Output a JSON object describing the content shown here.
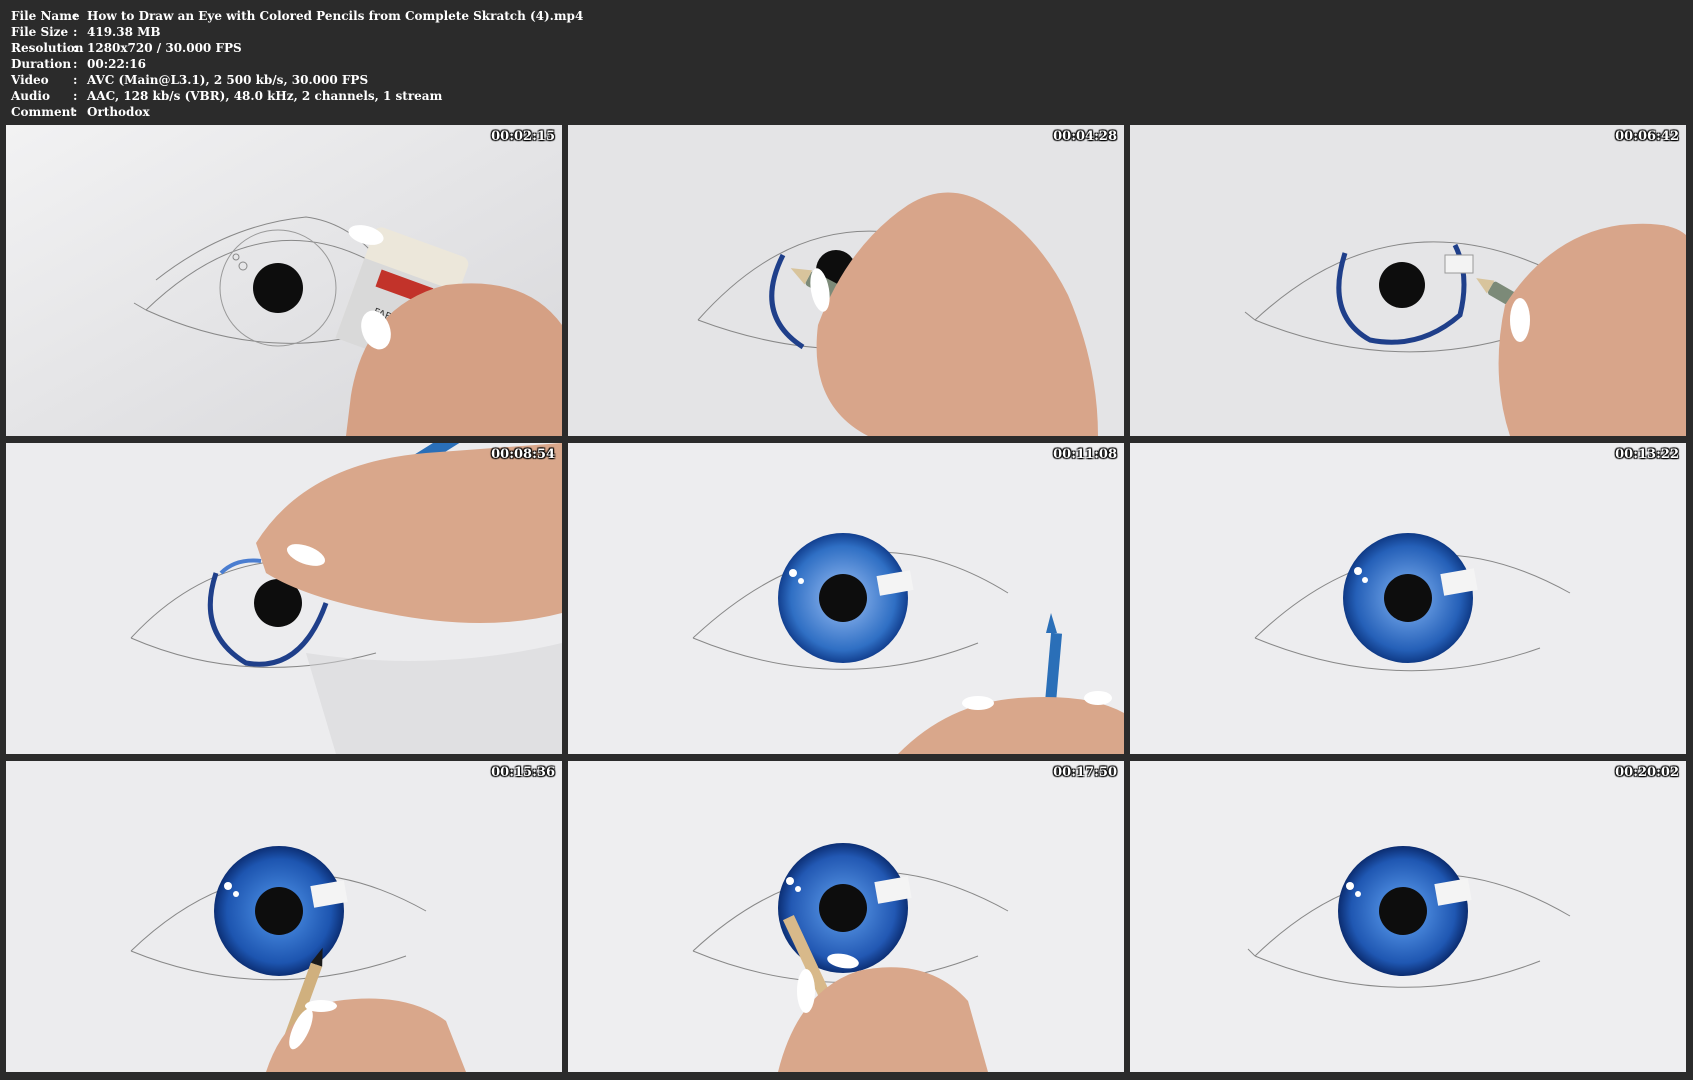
{
  "info": {
    "rows": [
      {
        "label": "File Name",
        "value": "How to Draw an Eye with Colored Pencils from Complete Skratch (4).mp4"
      },
      {
        "label": "File Size",
        "value": "419.38 MB"
      },
      {
        "label": "Resolution",
        "value": "1280x720 / 30.000 FPS"
      },
      {
        "label": "Duration",
        "value": "00:22:16"
      },
      {
        "label": "Video",
        "value": "AVC (Main@L3.1), 2 500 kb/s, 30.000 FPS"
      },
      {
        "label": "Audio",
        "value": "AAC, 128 kb/s (VBR), 48.0 kHz, 2 channels, 1 stream"
      },
      {
        "label": "Comment",
        "value": "Orthodox"
      }
    ],
    "separator": ":"
  },
  "thumbnails": [
    {
      "timestamp": "00:02:15",
      "scene": "sketch-eraser"
    },
    {
      "timestamp": "00:04:28",
      "scene": "outline-iris-pencil"
    },
    {
      "timestamp": "00:06:42",
      "scene": "iris-outlined-pencil"
    },
    {
      "timestamp": "00:08:54",
      "scene": "coloring-start-blue-pencil"
    },
    {
      "timestamp": "00:11:08",
      "scene": "iris-colored-blue"
    },
    {
      "timestamp": "00:13:22",
      "scene": "iris-colored-finished"
    },
    {
      "timestamp": "00:15:36",
      "scene": "iris-deep-blue-pencil"
    },
    {
      "timestamp": "00:17:50",
      "scene": "iris-detail-pencil"
    },
    {
      "timestamp": "00:20:02",
      "scene": "eye-final"
    }
  ],
  "colors": {
    "background": "#2b2b2b",
    "paper": "#e7e7e9",
    "iris_blue": "#2f6fc4",
    "iris_dark": "#123f8f",
    "pencil_green": "#7c8a78",
    "pencil_blue": "#2a6fb8",
    "skin": "#d9a78b"
  }
}
